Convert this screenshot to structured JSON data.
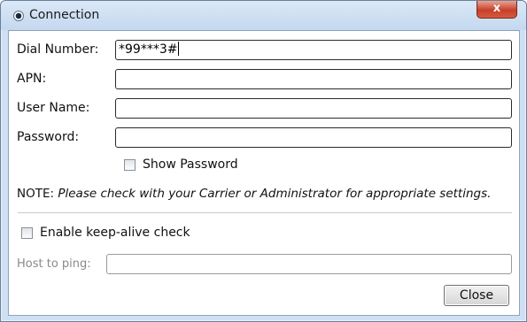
{
  "window": {
    "title": "Connection",
    "close_glyph": "x"
  },
  "form": {
    "dial_number": {
      "label": "Dial Number:",
      "value": "*99***3#"
    },
    "apn": {
      "label": "APN:",
      "value": ""
    },
    "user_name": {
      "label": "User Name:",
      "value": ""
    },
    "password": {
      "label": "Password:",
      "value": ""
    },
    "show_password": {
      "label": "Show Password",
      "checked": false
    },
    "note_prefix": "NOTE: ",
    "note_text": "Please check with your Carrier or Administrator for appropriate settings.",
    "keep_alive": {
      "label": "Enable keep-alive check",
      "checked": false
    },
    "host_to_ping": {
      "label": "Host to ping:",
      "value": "",
      "enabled": false
    }
  },
  "buttons": {
    "close_label": "Close"
  },
  "icons": {
    "app": "radio-dot-icon",
    "window_close": "close-icon"
  }
}
